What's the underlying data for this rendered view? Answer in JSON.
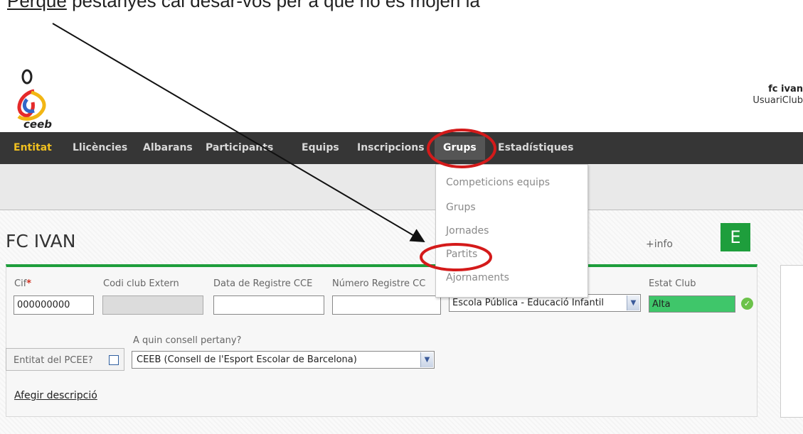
{
  "caption": {
    "underlined": "Perquè",
    "rest": " pestanyes cal desar-vos per a que no es mojen la"
  },
  "brand": {
    "logo_text": "ceeb"
  },
  "user": {
    "name": "fc ivan",
    "role": "UsuariClub"
  },
  "nav": {
    "items": [
      "Entitat",
      "Llicències",
      "Albarans",
      "Participants",
      "Equips",
      "Inscripcions",
      "Grups",
      "Estadístiques"
    ],
    "active": "Entitat",
    "open": "Grups"
  },
  "dropdown": {
    "items": [
      "Competicions equips",
      "Grups",
      "Jornades",
      "Partits",
      "Ajornaments"
    ]
  },
  "page": {
    "title": "FC IVAN",
    "more_info": "+info",
    "badge": "E"
  },
  "form": {
    "cif": {
      "label": "Cif",
      "required_mark": "*",
      "value": "000000000"
    },
    "codi_club_extern": {
      "label": "Codi club Extern",
      "value": ""
    },
    "data_registre": {
      "label": "Data de Registre CCE",
      "value": ""
    },
    "numero_registre": {
      "label": "Número Registre CC",
      "value": ""
    },
    "tipus": {
      "value": "Escola Pública - Educació Infantil"
    },
    "estat_club": {
      "label": "Estat Club",
      "value": "Alta"
    },
    "pcee": {
      "label": "Entitat del PCEE?"
    },
    "consell": {
      "label": "A quin consell pertany?",
      "value": "CEEB (Consell de l'Esport Escolar de Barcelona)"
    },
    "afegir_descripcio": "Afegir descripció"
  },
  "colors": {
    "nav_bg": "#363636",
    "accent_green": "#1e9e3c",
    "active_tab": "#f0c020",
    "annotation_red": "#d41a1a"
  },
  "icons": {
    "check": "check-circle-icon",
    "arrow": "select-arrow-icon"
  }
}
